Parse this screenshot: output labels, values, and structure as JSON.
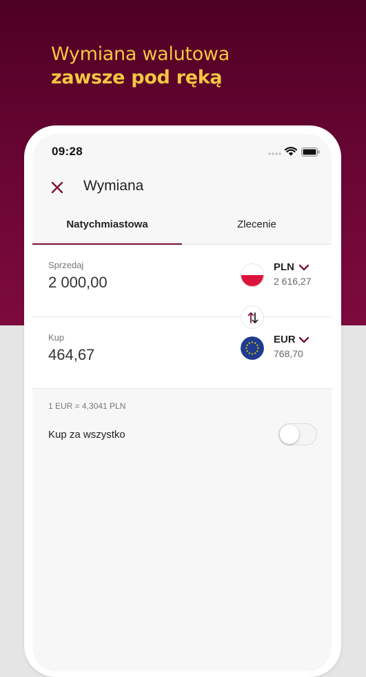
{
  "promo": {
    "headline_line1": "Wymiana walutowa",
    "headline_line2": "zawsze pod ręką"
  },
  "status_bar": {
    "time": "09:28"
  },
  "header": {
    "title": "Wymiana",
    "close_icon": "close-icon"
  },
  "tabs": [
    {
      "label": "Natychmiastowa",
      "active": true
    },
    {
      "label": "Zlecenie",
      "active": false
    }
  ],
  "sell": {
    "label": "Sprzedaj",
    "amount": "2 000,00",
    "currency": "PLN",
    "balance": "2 616,27",
    "flag": "poland-flag"
  },
  "buy": {
    "label": "Kup",
    "amount": "464,67",
    "currency": "EUR",
    "balance": "768,70",
    "flag": "eu-flag"
  },
  "exchange_rate": "1 EUR = 4,3041 PLN",
  "buy_all": {
    "label": "Kup za wszystko",
    "enabled": false
  },
  "colors": {
    "brand": "#7a1038",
    "hero_bg": "#5e0330",
    "headline": "#f5c542",
    "eu_blue": "#1f3c8f",
    "eu_star": "#f7d000",
    "poland_red": "#dc143c"
  }
}
